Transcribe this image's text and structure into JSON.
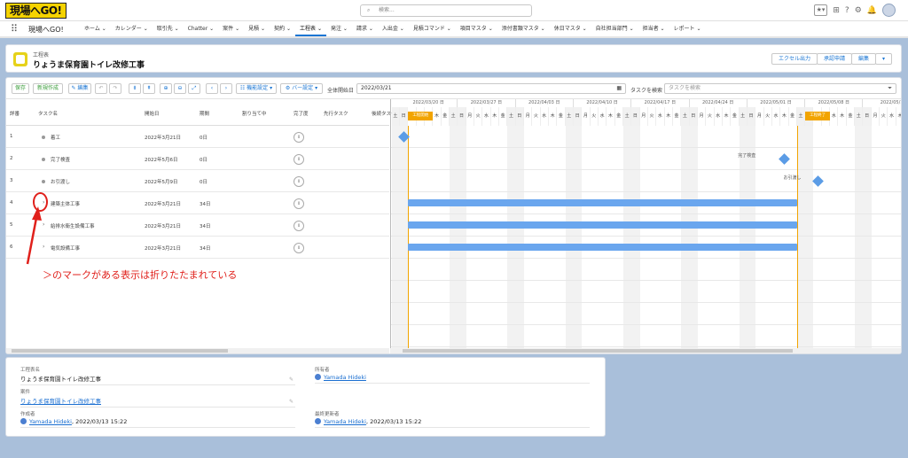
{
  "app": {
    "logo": "現場へGO!",
    "name": "現場へGO!"
  },
  "search": {
    "placeholder": "検索..."
  },
  "nav": {
    "items": [
      "ホーム",
      "カレンダー",
      "取引先",
      "Chatter",
      "案件",
      "見積",
      "契約",
      "工程表",
      "発注",
      "請求",
      "入出金",
      "見積コマンド",
      "項目マスタ",
      "添付書類マスタ",
      "休日マスタ",
      "自社担当部門",
      "担当者",
      "レポート"
    ],
    "active": 7
  },
  "record": {
    "object": "工程表",
    "title": "りょうま保育園トイレ改修工事"
  },
  "header_buttons": [
    "エクセル出力",
    "承認申請",
    "編集"
  ],
  "toolbar": {
    "save": "保存",
    "new": "新規作成",
    "edit": "編集",
    "display_settings": "機能設定",
    "bar_settings": "バー設定",
    "start_label": "全体開始日",
    "start_date": "2022/03/21",
    "task_search_label": "タスクを検索",
    "task_search_placeholder": "タスクを検索"
  },
  "grid": {
    "columns": [
      "詳番",
      "タスク名",
      "開始日",
      "期間",
      "割り当て中",
      "完了度",
      "先行タスク",
      "後続タスク"
    ],
    "rows": [
      {
        "no": "1",
        "name": "着工",
        "start": "2022年3月21日",
        "duration": "0日",
        "progress": "0",
        "type": "milestone"
      },
      {
        "no": "2",
        "name": "完了検査",
        "start": "2022年5月6日",
        "duration": "0日",
        "progress": "0",
        "type": "milestone"
      },
      {
        "no": "3",
        "name": "お引渡し",
        "start": "2022年5月9日",
        "duration": "0日",
        "progress": "0",
        "type": "milestone"
      },
      {
        "no": "4",
        "name": "建築主体工事",
        "start": "2022年3月21日",
        "duration": "34日",
        "progress": "0",
        "type": "group"
      },
      {
        "no": "5",
        "name": "給排水衛生設備工事",
        "start": "2022年3月21日",
        "duration": "34日",
        "progress": "0",
        "type": "group"
      },
      {
        "no": "6",
        "name": "電気設備工事",
        "start": "2022年3月21日",
        "duration": "34日",
        "progress": "0",
        "type": "group"
      }
    ]
  },
  "gantt": {
    "weeks": [
      "2022/03/20 日",
      "2022/03/27 日",
      "2022/04/03 日",
      "2022/04/10 日",
      "2022/04/17 日",
      "2022/04/24 日",
      "2022/05/01 日",
      "2022/05/08 日",
      "2022/05/1"
    ],
    "day_labels": [
      "日",
      "月",
      "火",
      "水",
      "木",
      "金",
      "土"
    ],
    "start_marker": "工程開始",
    "end_marker": "工程終了",
    "milestone_labels": [
      "完了検査",
      "お引渡し"
    ]
  },
  "annotation": "＞のマークがある表示は折りたたまれている",
  "details": {
    "name_label": "工程表名",
    "name_value": "りょうま保育園トイレ改修工事",
    "owner_label": "所有者",
    "owner_value": "Yamada Hideki",
    "deal_label": "案件",
    "deal_value": "りょうま保育園トイレ改修工事",
    "created_label": "作成者",
    "created_user": "Yamada Hideki",
    "created_time": ", 2022/03/13 15:22",
    "modified_label": "最終更新者",
    "modified_user": "Yamada Hideki",
    "modified_time": ", 2022/03/13 15:22"
  },
  "colors": {
    "bar": "#6aa6ee",
    "milestone": "#5b9ce6",
    "marker": "#f2a400",
    "annotation": "#e0201b",
    "accent": "#1b76d3"
  },
  "icons": [
    "app-launcher-icon",
    "search-icon",
    "favorite-star-icon",
    "add-icon",
    "help-icon",
    "settings-icon",
    "bell-icon",
    "avatar",
    "chevron-icon",
    "calendar-icon",
    "filter-icon",
    "pencil-icon",
    "user-icon"
  ]
}
